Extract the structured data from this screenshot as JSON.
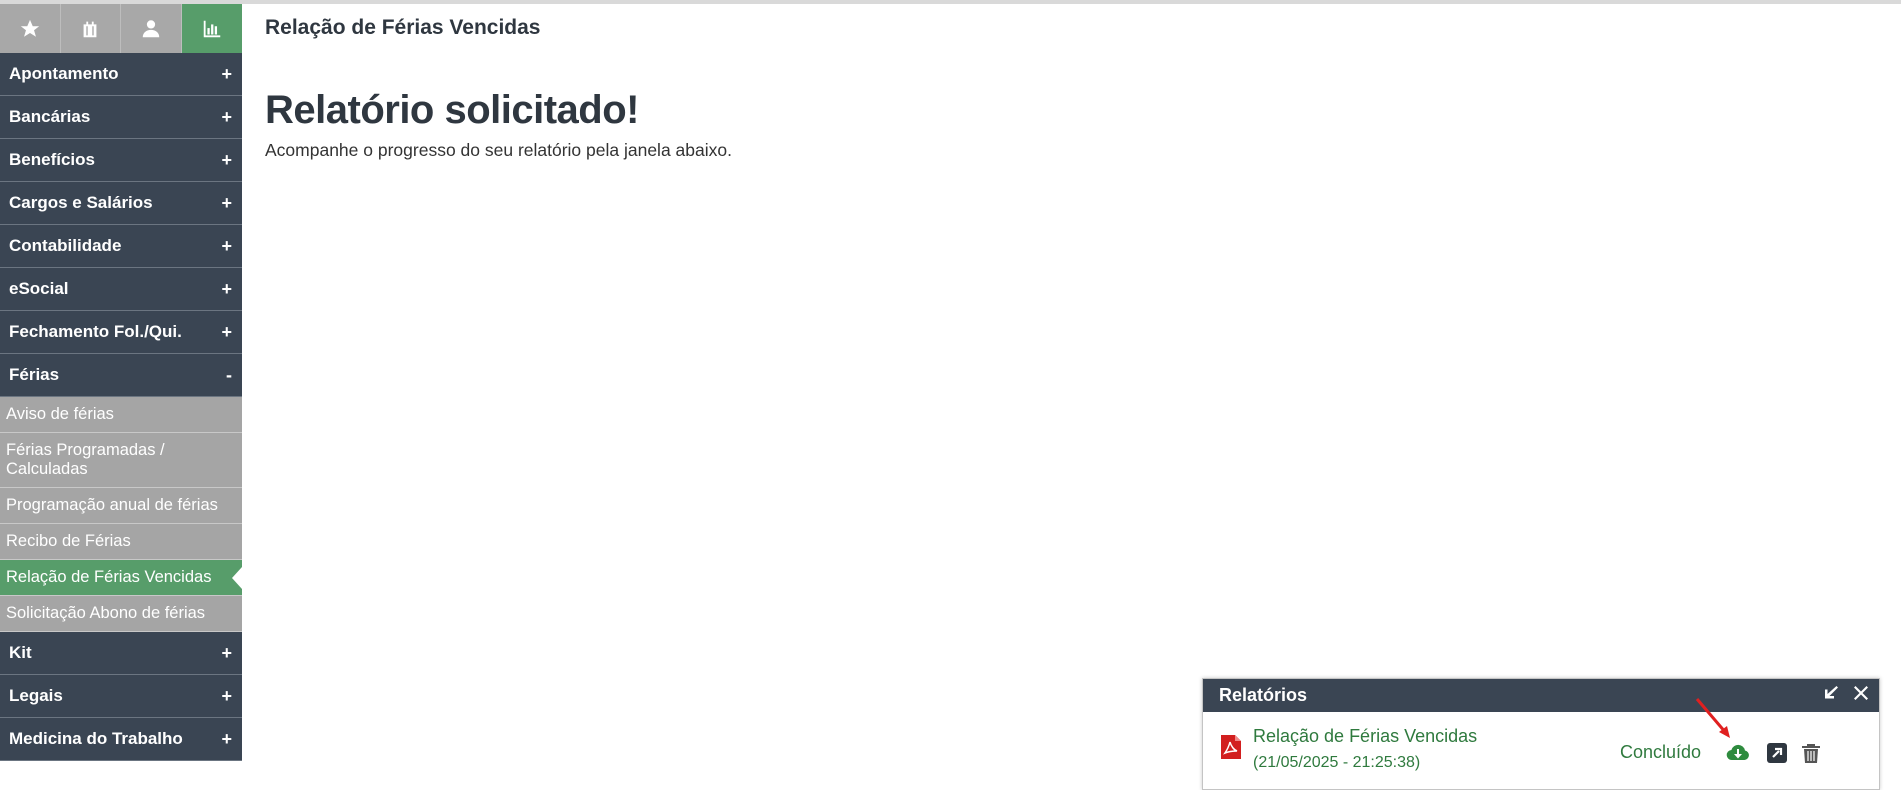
{
  "sidebar": {
    "tabs": [
      {
        "icon": "star-icon"
      },
      {
        "icon": "briefcase-icon"
      },
      {
        "icon": "user-icon"
      },
      {
        "icon": "bar-chart-icon",
        "active": true
      }
    ],
    "menu_before": [
      {
        "label": "Apontamento",
        "sign": "+"
      },
      {
        "label": "Bancárias",
        "sign": "+"
      },
      {
        "label": "Benefícios",
        "sign": "+"
      },
      {
        "label": "Cargos e Salários",
        "sign": "+"
      },
      {
        "label": "Contabilidade",
        "sign": "+"
      },
      {
        "label": "eSocial",
        "sign": "+"
      },
      {
        "label": "Fechamento Fol./Qui.",
        "sign": "+"
      },
      {
        "label": "Férias",
        "sign": "-"
      }
    ],
    "ferias_sub": [
      {
        "label": "Aviso de férias"
      },
      {
        "label": "Férias Programadas / Calculadas"
      },
      {
        "label": "Programação anual de férias"
      },
      {
        "label": "Recibo de Férias"
      },
      {
        "label": "Relação de Férias Vencidas",
        "active": true
      },
      {
        "label": "Solicitação Abono de férias"
      }
    ],
    "menu_after": [
      {
        "label": "Kit",
        "sign": "+"
      },
      {
        "label": "Legais",
        "sign": "+"
      },
      {
        "label": "Medicina do Trabalho",
        "sign": "+"
      }
    ]
  },
  "main": {
    "page_title": "Relação de Férias Vencidas",
    "heading": "Relatório solicitado!",
    "subtext": "Acompanhe o progresso do seu relatório pela janela abaixo."
  },
  "reports_panel": {
    "title": "Relatórios",
    "items": [
      {
        "name": "Relação de Férias Vencidas",
        "date": "(21/05/2025 - 21:25:38)",
        "status": "Concluído",
        "file_icon": "pdf-icon"
      }
    ]
  },
  "colors": {
    "sidebar_dark": "#3a4553",
    "accent_green": "#579d6a",
    "submenu_gray": "#a5a5a5",
    "report_text_green": "#2f7a3e",
    "annotation_red": "#e02020"
  }
}
